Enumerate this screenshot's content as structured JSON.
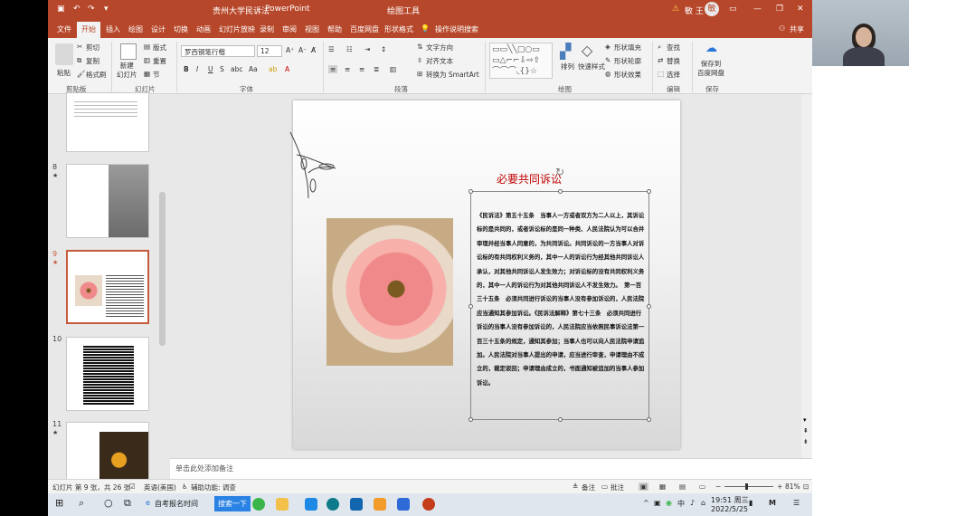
{
  "titlebar": {
    "doc_title": "贵州大学民诉法",
    "app_name": "PowerPoint",
    "context_tool": "绘图工具",
    "user": "敏 王",
    "user_initial": "敏"
  },
  "tabs": [
    "文件",
    "开始",
    "插入",
    "绘图",
    "设计",
    "切换",
    "动画",
    "幻灯片放映",
    "录制",
    "审阅",
    "视图",
    "帮助",
    "百度网盘",
    "形状格式"
  ],
  "active_tab": "开始",
  "tell_me": "操作说明搜索",
  "share": "共享",
  "ribbon": {
    "clipboard": {
      "paste": "粘贴",
      "cut": "剪切",
      "copy": "复制",
      "format_painter": "格式刷",
      "label": "剪贴板"
    },
    "slides": {
      "new_slide": "新建\n幻灯片",
      "layout": "版式",
      "reset": "重置",
      "section": "节",
      "label": "幻灯片"
    },
    "font": {
      "name": "罗西钢笔行楷",
      "size": "12",
      "bold": "B",
      "italic": "I",
      "underline": "U",
      "strike": "S",
      "spacing": "abc",
      "aa": "Aa",
      "label": "字体"
    },
    "paragraph": {
      "text_direction": "文字方向",
      "align_text": "对齐文本",
      "smartart": "转换为 SmartArt",
      "label": "段落"
    },
    "drawing": {
      "arrange": "排列",
      "quick_styles": "快速样式",
      "fill": "形状填充",
      "outline": "形状轮廓",
      "effects": "形状效果",
      "label": "绘图"
    },
    "editing": {
      "find": "查找",
      "replace": "替换",
      "select": "选择",
      "label": "编辑"
    },
    "save": {
      "save_to": "保存到\n百度网盘",
      "label": "保存"
    }
  },
  "thumbnails": [
    {
      "number": "8",
      "star": "★"
    },
    {
      "number": "9",
      "star": "★",
      "selected": true
    },
    {
      "number": "10",
      "star": ""
    },
    {
      "number": "11",
      "star": "★"
    }
  ],
  "slide": {
    "title": "必要共同诉讼",
    "body": "《民诉法》第五十五条　当事人一方或者双方为二人以上，其诉讼标的是共同的，或者诉讼标的是同一种类、人民法院认为可以合并审理并经当事人同意的，为共同诉讼。共同诉讼的一方当事人对诉讼标的有共同权利义务的，其中一人的诉讼行为经其他共同诉讼人承认，对其他共同诉讼人发生效力；对诉讼标的没有共同权利义务的，其中一人的诉讼行为对其他共同诉讼人不发生效力。　第一百三十五条　必须共同进行诉讼的当事人没有参加诉讼的，人民法院应当通知其参加诉讼。《民诉法解释》第七十三条　必须共同进行诉讼的当事人没有参加诉讼的，人民法院应当依照民事诉讼法第一百三十五条的规定，通知其参加；当事人也可以向人民法院申请追加。人民法院对当事人提出的申请，应当进行审查，申请理由不成立的，裁定驳回；申请理由成立的，书面通知被追加的当事人参加诉讼。"
  },
  "notes_placeholder": "单击此处添加备注",
  "status": {
    "slide_info": "幻灯片 第 9 张，共 26 张",
    "language": "英语(美国)",
    "accessibility": "辅助功能: 调查",
    "notes": "备注",
    "comments": "批注",
    "zoom": "81%"
  },
  "taskbar": {
    "app1": "自考报名时间",
    "search": "搜索一下",
    "ime": "中",
    "time": "19:51 周三",
    "date": "2022/5/25"
  }
}
